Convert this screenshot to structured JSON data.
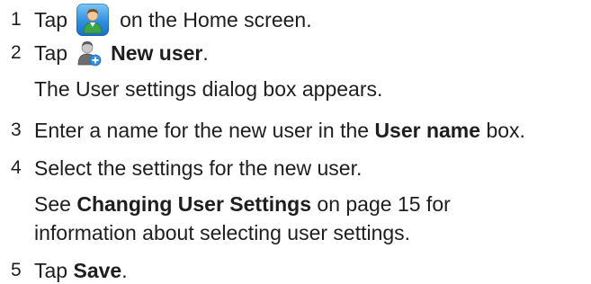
{
  "steps": [
    {
      "number": "1",
      "before": "Tap",
      "after": "on the Home screen.",
      "icon": "user-tile-icon"
    },
    {
      "number": "2",
      "before": "Tap",
      "bold": "New user",
      "after": ".",
      "icon": "new-user-icon"
    },
    {
      "note": "The User settings dialog box appears."
    },
    {
      "number": "3",
      "before": "Enter a name for the new user in the ",
      "bold": "User name",
      "after": " box."
    },
    {
      "number": "4",
      "text": "Select the settings for the new user."
    },
    {
      "note_bold": "Changing User Settings",
      "note_before": "See ",
      "note_after": " on page 15 for"
    },
    {
      "note": "information about selecting user settings."
    },
    {
      "number": "5",
      "before": "Tap ",
      "bold": "Save",
      "after": "."
    }
  ],
  "colors": {
    "text": "#1e1e1e",
    "tile_blue": "#2f8fe0"
  }
}
